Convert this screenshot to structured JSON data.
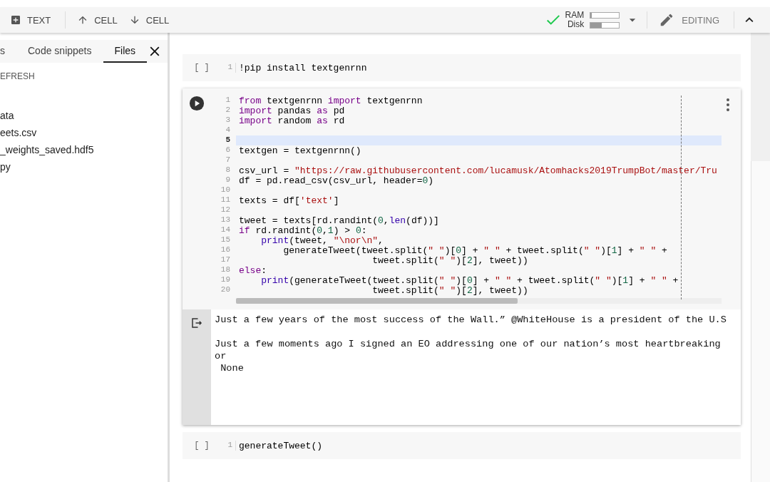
{
  "toolbar": {
    "left": [
      {
        "kind": "add",
        "label": "TEXT"
      },
      {
        "kind": "up",
        "label": "CELL"
      },
      {
        "kind": "down",
        "label": "CELL"
      }
    ],
    "status": {
      "connected": true,
      "ram_label": "RAM",
      "ram": {
        "level": 0.05
      },
      "disk_label": "Disk",
      "disk": {
        "level": 0.4
      }
    },
    "mode": "EDITING"
  },
  "sidebar": {
    "tabs": [
      {
        "label": "s",
        "selected": false
      },
      {
        "label": "Code snippets",
        "selected": false
      },
      {
        "label": "Files",
        "selected": true
      }
    ],
    "refresh": "EFRESH",
    "files": [
      "ata",
      "eets.csv",
      "_weights_saved.hdf5",
      "py"
    ]
  },
  "cells": [
    {
      "focused": false,
      "exec": "[ ]",
      "lines": [
        {
          "n": "1",
          "active": false,
          "code": [
            {
              "kind": "plain",
              "text": "!pip install textgenrnn"
            }
          ]
        }
      ]
    },
    {
      "focused": true,
      "lines": [
        {
          "n": "1",
          "active": false,
          "code": [
            {
              "kind": "keyword",
              "text": "from"
            },
            {
              "kind": "plain",
              "text": " textgenrnn "
            },
            {
              "kind": "keyword",
              "text": "import"
            },
            {
              "kind": "plain",
              "text": " textgenrnn"
            }
          ]
        },
        {
          "n": "2",
          "active": false,
          "code": [
            {
              "kind": "keyword",
              "text": "import"
            },
            {
              "kind": "plain",
              "text": " pandas "
            },
            {
              "kind": "keyword",
              "text": "as"
            },
            {
              "kind": "plain",
              "text": " pd"
            }
          ]
        },
        {
          "n": "3",
          "active": false,
          "code": [
            {
              "kind": "keyword",
              "text": "import"
            },
            {
              "kind": "plain",
              "text": " random "
            },
            {
              "kind": "keyword",
              "text": "as"
            },
            {
              "kind": "plain",
              "text": " rd"
            }
          ]
        },
        {
          "n": "4",
          "active": false
        },
        {
          "n": "5",
          "active": true
        },
        {
          "n": "6",
          "active": false,
          "code": [
            {
              "kind": "plain",
              "text": "textgen = textgenrnn()"
            }
          ]
        },
        {
          "n": "7",
          "active": false
        },
        {
          "n": "8",
          "active": false,
          "code": [
            {
              "kind": "plain",
              "text": "csv_url = "
            },
            {
              "kind": "string",
              "text": "\"https://raw.githubusercontent.com/lucamusk/Atomhacks2019TrumpBot/master/Tru"
            }
          ]
        },
        {
          "n": "9",
          "active": false,
          "code": [
            {
              "kind": "plain",
              "text": "df = pd.read_csv(csv_url, header="
            },
            {
              "kind": "number",
              "text": "0"
            },
            {
              "kind": "plain",
              "text": ")"
            }
          ]
        },
        {
          "n": "10",
          "active": false
        },
        {
          "n": "11",
          "active": false,
          "code": [
            {
              "kind": "plain",
              "text": "texts = df["
            },
            {
              "kind": "string",
              "text": "'text'"
            },
            {
              "kind": "plain",
              "text": "]"
            }
          ]
        },
        {
          "n": "12",
          "active": false
        },
        {
          "n": "13",
          "active": false,
          "code": [
            {
              "kind": "plain",
              "text": "tweet = texts[rd.randint("
            },
            {
              "kind": "number",
              "text": "0"
            },
            {
              "kind": "plain",
              "text": ","
            },
            {
              "kind": "builtin",
              "text": "len"
            },
            {
              "kind": "plain",
              "text": "(df))]"
            }
          ]
        },
        {
          "n": "14",
          "active": false,
          "code": [
            {
              "kind": "keyword",
              "text": "if"
            },
            {
              "kind": "plain",
              "text": " rd.randint("
            },
            {
              "kind": "number",
              "text": "0"
            },
            {
              "kind": "plain",
              "text": ","
            },
            {
              "kind": "number",
              "text": "1"
            },
            {
              "kind": "plain",
              "text": ") > "
            },
            {
              "kind": "number",
              "text": "0"
            },
            {
              "kind": "plain",
              "text": ":"
            }
          ]
        },
        {
          "n": "15",
          "active": false,
          "code": [
            {
              "kind": "builtin",
              "text": "    print"
            },
            {
              "kind": "plain",
              "text": "(tweet, "
            },
            {
              "kind": "string",
              "text": "\"\\nor\\n\""
            },
            {
              "kind": "plain",
              "text": ","
            }
          ]
        },
        {
          "n": "16",
          "active": false,
          "code": [
            {
              "kind": "plain",
              "text": "        generateTweet(tweet.split("
            },
            {
              "kind": "string",
              "text": "\" \""
            },
            {
              "kind": "plain",
              "text": ")["
            },
            {
              "kind": "number",
              "text": "0"
            },
            {
              "kind": "plain",
              "text": "] + "
            },
            {
              "kind": "string",
              "text": "\" \""
            },
            {
              "kind": "plain",
              "text": " + tweet.split("
            },
            {
              "kind": "string",
              "text": "\" \""
            },
            {
              "kind": "plain",
              "text": ")["
            },
            {
              "kind": "number",
              "text": "1"
            },
            {
              "kind": "plain",
              "text": "] + "
            },
            {
              "kind": "string",
              "text": "\" \""
            },
            {
              "kind": "plain",
              "text": " +"
            }
          ]
        },
        {
          "n": "17",
          "active": false,
          "code": [
            {
              "kind": "plain",
              "text": "                        tweet.split("
            },
            {
              "kind": "string",
              "text": "\" \""
            },
            {
              "kind": "plain",
              "text": ")["
            },
            {
              "kind": "number",
              "text": "2"
            },
            {
              "kind": "plain",
              "text": "], tweet))"
            }
          ]
        },
        {
          "n": "18",
          "active": false,
          "code": [
            {
              "kind": "keyword",
              "text": "else"
            },
            {
              "kind": "plain",
              "text": ":"
            }
          ]
        },
        {
          "n": "19",
          "active": false,
          "code": [
            {
              "kind": "builtin",
              "text": "    print"
            },
            {
              "kind": "plain",
              "text": "(generateTweet(tweet.split("
            },
            {
              "kind": "string",
              "text": "\" \""
            },
            {
              "kind": "plain",
              "text": ")["
            },
            {
              "kind": "number",
              "text": "0"
            },
            {
              "kind": "plain",
              "text": "] + "
            },
            {
              "kind": "string",
              "text": "\" \""
            },
            {
              "kind": "plain",
              "text": " + tweet.split("
            },
            {
              "kind": "string",
              "text": "\" \""
            },
            {
              "kind": "plain",
              "text": ")["
            },
            {
              "kind": "number",
              "text": "1"
            },
            {
              "kind": "plain",
              "text": "] + "
            },
            {
              "kind": "string",
              "text": "\" \""
            },
            {
              "kind": "plain",
              "text": " +"
            }
          ]
        },
        {
          "n": "20",
          "active": false,
          "code": [
            {
              "kind": "plain",
              "text": "                        tweet.split("
            },
            {
              "kind": "string",
              "text": "\" \""
            },
            {
              "kind": "plain",
              "text": ")["
            },
            {
              "kind": "number",
              "text": "2"
            },
            {
              "kind": "plain",
              "text": "], tweet))"
            }
          ]
        }
      ],
      "output": [
        [
          "Just a few years of the most success of the Wall.” @WhiteHouse is a president of the U.S"
        ],
        [
          "Just a few moments ago I signed an EO addressing one of our nation’s most heartbreaking",
          "or",
          " None"
        ]
      ]
    },
    {
      "focused": false,
      "exec": "[ ]",
      "lines": [
        {
          "n": "1",
          "active": false,
          "code": [
            {
              "kind": "plain",
              "text": "generateTweet()"
            }
          ]
        }
      ]
    }
  ]
}
